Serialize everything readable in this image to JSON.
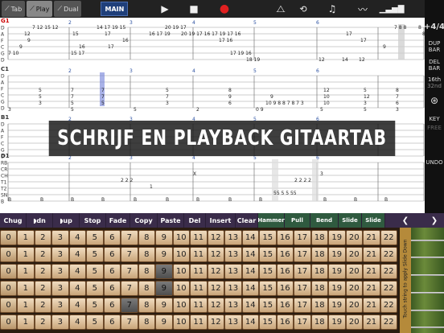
{
  "top": {
    "modes": [
      {
        "label": "Tab"
      },
      {
        "label": "Play"
      },
      {
        "label": "Dual"
      }
    ],
    "main_label": "MAIN",
    "play_icon": "play-icon",
    "stop_icon": "stop-icon",
    "record_icon": "record-icon",
    "metronome_icon": "metronome-icon",
    "loop_icon": "loop-icon",
    "note_icon": "note-icon",
    "graph_icon": "graph-icon",
    "bars_icon": "bars-icon",
    "home_icon": "home-icon"
  },
  "right": {
    "time_sig": "+4/4",
    "dup_bar": "DUP BAR",
    "del_bar": "DEL BAR",
    "note_value": "16th",
    "note_sub": "32nd",
    "key": "KEY",
    "free": "FREE",
    "undo": "UNDO"
  },
  "staff": {
    "tracks": [
      {
        "id": "G1",
        "strings": [
          "D",
          "A",
          "F",
          "C",
          "G",
          "D"
        ]
      },
      {
        "id": "C1",
        "strings": [
          "D",
          "A",
          "F",
          "C",
          "G",
          "D"
        ]
      },
      {
        "id": "B1",
        "strings": [
          "D",
          "A",
          "F",
          "C",
          "G",
          "D"
        ]
      },
      {
        "id": "D1",
        "strings": [
          "RB",
          "CR",
          "CH",
          "T1",
          "T2",
          "SN",
          "B"
        ]
      }
    ],
    "measure_numbers": [
      "1",
      "2",
      "3",
      "4",
      "5",
      "6"
    ]
  },
  "banner": "Schrijf en playback gitaartab",
  "commands": [
    "Chug",
    "dn",
    "up",
    "Stop",
    "Fade",
    "Copy",
    "Paste",
    "Del",
    "Insert",
    "Clear",
    "Hammer",
    "Pull",
    "Bend",
    "Slide",
    "Slide"
  ],
  "frets": [
    "0",
    "1",
    "2",
    "3",
    "4",
    "5",
    "6",
    "7",
    "8",
    "9",
    "10",
    "11",
    "12",
    "13",
    "14",
    "15",
    "16",
    "17",
    "18",
    "19",
    "20",
    "21",
    "22"
  ],
  "slide_hint": "Touch string to apply Slide Down",
  "colors": {
    "main_blue": "#1f3f7a",
    "record_red": "#e02020",
    "highlight": "#6f7ed8"
  }
}
